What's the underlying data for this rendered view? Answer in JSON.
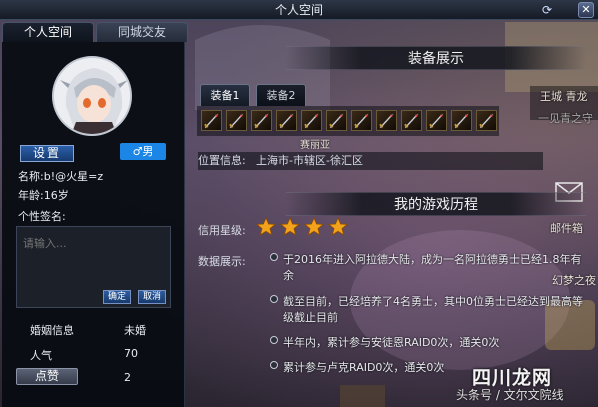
{
  "window": {
    "title": "个人空间"
  },
  "tabs": [
    {
      "label": "个人空间",
      "active": true
    },
    {
      "label": "同城交友",
      "active": false
    }
  ],
  "profile": {
    "set_label": "设置",
    "gender_label": "♂男",
    "name_label": "名称:",
    "name_value": "b!@火星=z",
    "age_label": "年龄:",
    "age_value": "16岁",
    "signature_label": "个性签名:",
    "signature_placeholder": "请输入...",
    "ok_label": "确定",
    "cancel_label": "取消",
    "stats": [
      {
        "label": "婚姻信息",
        "value": "未婚"
      },
      {
        "label": "人气",
        "value": "70"
      },
      {
        "label": "点赞",
        "value": "2"
      }
    ]
  },
  "equipment": {
    "title": "装备展示",
    "tabs": [
      "装备1",
      "装备2"
    ],
    "slot_count": 12,
    "slot_icon": "sword-icon"
  },
  "location": {
    "label": "位置信息:",
    "value": "上海市-市辖区-徐汇区"
  },
  "history": {
    "title": "我的游戏历程",
    "rating_label": "信用星级:",
    "stars": 4,
    "records_label": "数据展示:",
    "records": [
      "于2016年进入阿拉德大陆，成为一名阿拉德勇士已经1.8年有余",
      "截至目前，已经培养了4名勇士，其中0位勇士已经达到最高等级截止目前",
      "半年内，累计参与安徒恩RAID0次，通关0次",
      "累计参与卢克RAID0次，通关0次"
    ]
  },
  "background_text": {
    "signpost": "赛丽亚",
    "mail": "邮件箱",
    "quest": "一见青之守",
    "npc": "幻梦之夜",
    "side": "王城 青龙"
  },
  "watermark": {
    "brand": "四川龙网",
    "caption": "头条号 / 文尔文院线"
  },
  "colors": {
    "accent": "#1b86e6",
    "star": "#f3a21b"
  }
}
